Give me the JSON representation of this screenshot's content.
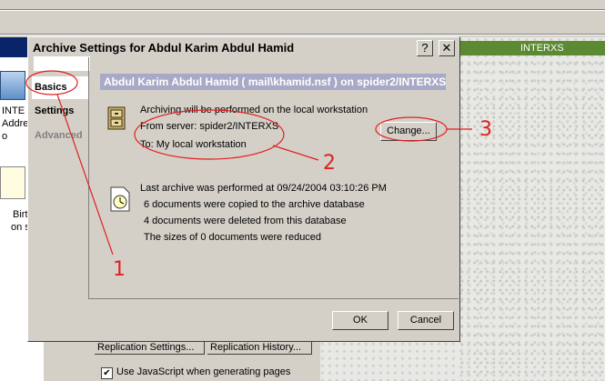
{
  "background": {
    "right_panel_label": "INTERXS",
    "left_item1_lines": [
      "INTE",
      "Addre",
      "o"
    ],
    "left_item2_lines": [
      "Birt",
      "on s"
    ],
    "buttons": [
      "Replication Settings...",
      "Replication History..."
    ],
    "checkbox_label": "Use JavaScript when generating pages",
    "checkbox_mark": "✔"
  },
  "dialog": {
    "title": "Archive Settings for Abdul Karim Abdul Hamid",
    "help_glyph": "?",
    "close_glyph": "✕",
    "tabs": [
      {
        "label": "Basics",
        "selected": true
      },
      {
        "label": "Settings",
        "selected": false
      },
      {
        "label": "Advanced",
        "selected": false
      }
    ],
    "header": "Abdul Karim Abdul Hamid ( mail\\khamid.nsf ) on spider2/INTERXS",
    "archive_location": {
      "line1": "Archiving will be performed on the local workstation",
      "line2": "From server: spider2/INTERXS",
      "line3": "To: My local workstation"
    },
    "change_button": "Change...",
    "last_archive": {
      "line1": "Last archive was performed at 09/24/2004 03:10:26 PM",
      "line2": "6 documents were copied to the archive database",
      "line3": "4 documents were deleted from this database",
      "line4": "The sizes of 0 documents were reduced"
    },
    "ok_button": "OK",
    "cancel_button": "Cancel"
  },
  "annotations": {
    "labels": [
      "1",
      "2",
      "3"
    ],
    "color": "#e02020"
  },
  "colors": {
    "header_bg": "#a7a9c6",
    "dialog_bg": "#d4d0c8",
    "annotation": "#e02020"
  }
}
